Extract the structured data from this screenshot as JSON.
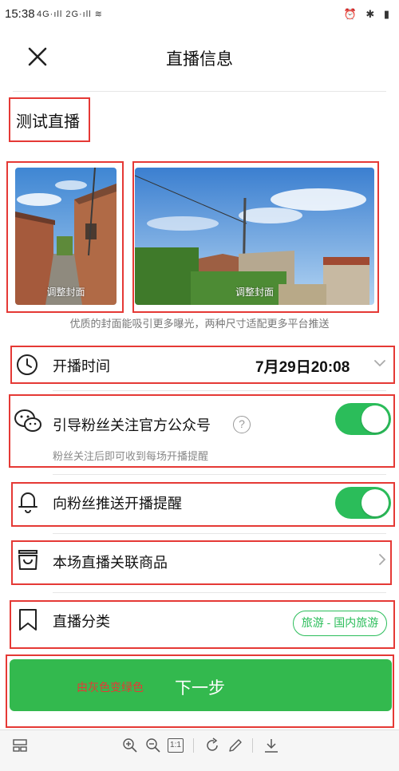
{
  "status_bar": {
    "time": "15:38",
    "left_icons": "4G·ıll 2G·ıll ≋",
    "right_icons": "⏰ ✱ ▮"
  },
  "header": {
    "title": "直播信息",
    "close_icon": "close-icon"
  },
  "live": {
    "title": "测试直播"
  },
  "covers": {
    "portrait_caption": "调整封面",
    "landscape_caption": "调整封面",
    "tip": "优质的封面能吸引更多曝光，两种尺寸适配更多平台推送"
  },
  "settings": {
    "start_time": {
      "label": "开播时间",
      "value": "7月29日20:08",
      "icon": "clock-icon"
    },
    "follow_guide": {
      "label": "引导粉丝关注官方公众号",
      "sub": "粉丝关注后即可收到每场开播提醒",
      "help": "?",
      "icon": "wechat-icon",
      "enabled": true
    },
    "push_reminder": {
      "label": "向粉丝推送开播提醒",
      "icon": "bell-icon",
      "enabled": true
    },
    "products": {
      "label": "本场直播关联商品",
      "icon": "shopping-bag-icon"
    },
    "category": {
      "label": "直播分类",
      "value": "旅游 - 国内旅游",
      "icon": "bookmark-icon"
    }
  },
  "next_button": {
    "label": "下一步",
    "annotation": "由灰色变绿色"
  },
  "colors": {
    "accent_green": "#2bbd5a",
    "button_green": "#33b94e",
    "annotation_red": "#e53935"
  },
  "toolbar": {
    "icons": [
      "layout-icon",
      "zoom-in-icon",
      "zoom-out-icon",
      "actual-size-icon",
      "rotate-icon",
      "edit-icon",
      "download-icon"
    ],
    "actual_size_label": "1:1"
  }
}
